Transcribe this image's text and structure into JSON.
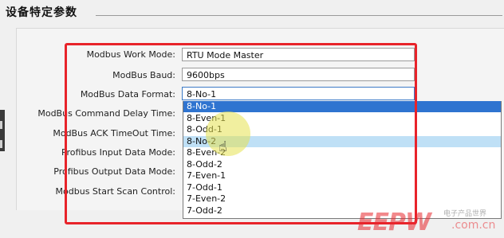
{
  "section": {
    "title": "设备特定参数"
  },
  "params": {
    "work_mode_label": "Modbus Work Mode:",
    "work_mode_value": "RTU Mode Master",
    "baud_label": "ModBus Baud:",
    "baud_value": "9600bps",
    "data_format_label": "ModBus Data Format:",
    "data_format_value": "8-No-1",
    "cmd_delay_label": "ModBus Command Delay Time:",
    "ack_timeout_label": "ModBus ACK TimeOut Time:",
    "pb_input_label": "Profibus Input Data Mode:",
    "pb_output_label": "Profibus Output Data Mode:",
    "scan_control_label": "Modbus Start Scan Control:"
  },
  "dropdown": {
    "options": [
      "8-No-1",
      "8-Even-1",
      "8-Odd-1",
      "8-No-2",
      "8-Even-2",
      "8-Odd-2",
      "7-Even-1",
      "7-Odd-1",
      "7-Even-2",
      "7-Odd-2"
    ],
    "selected_index": 0,
    "hover_index": 3
  },
  "watermark": {
    "logo": "EEPW",
    "tagline": "电子产品世界",
    "url": ".com.cn"
  }
}
